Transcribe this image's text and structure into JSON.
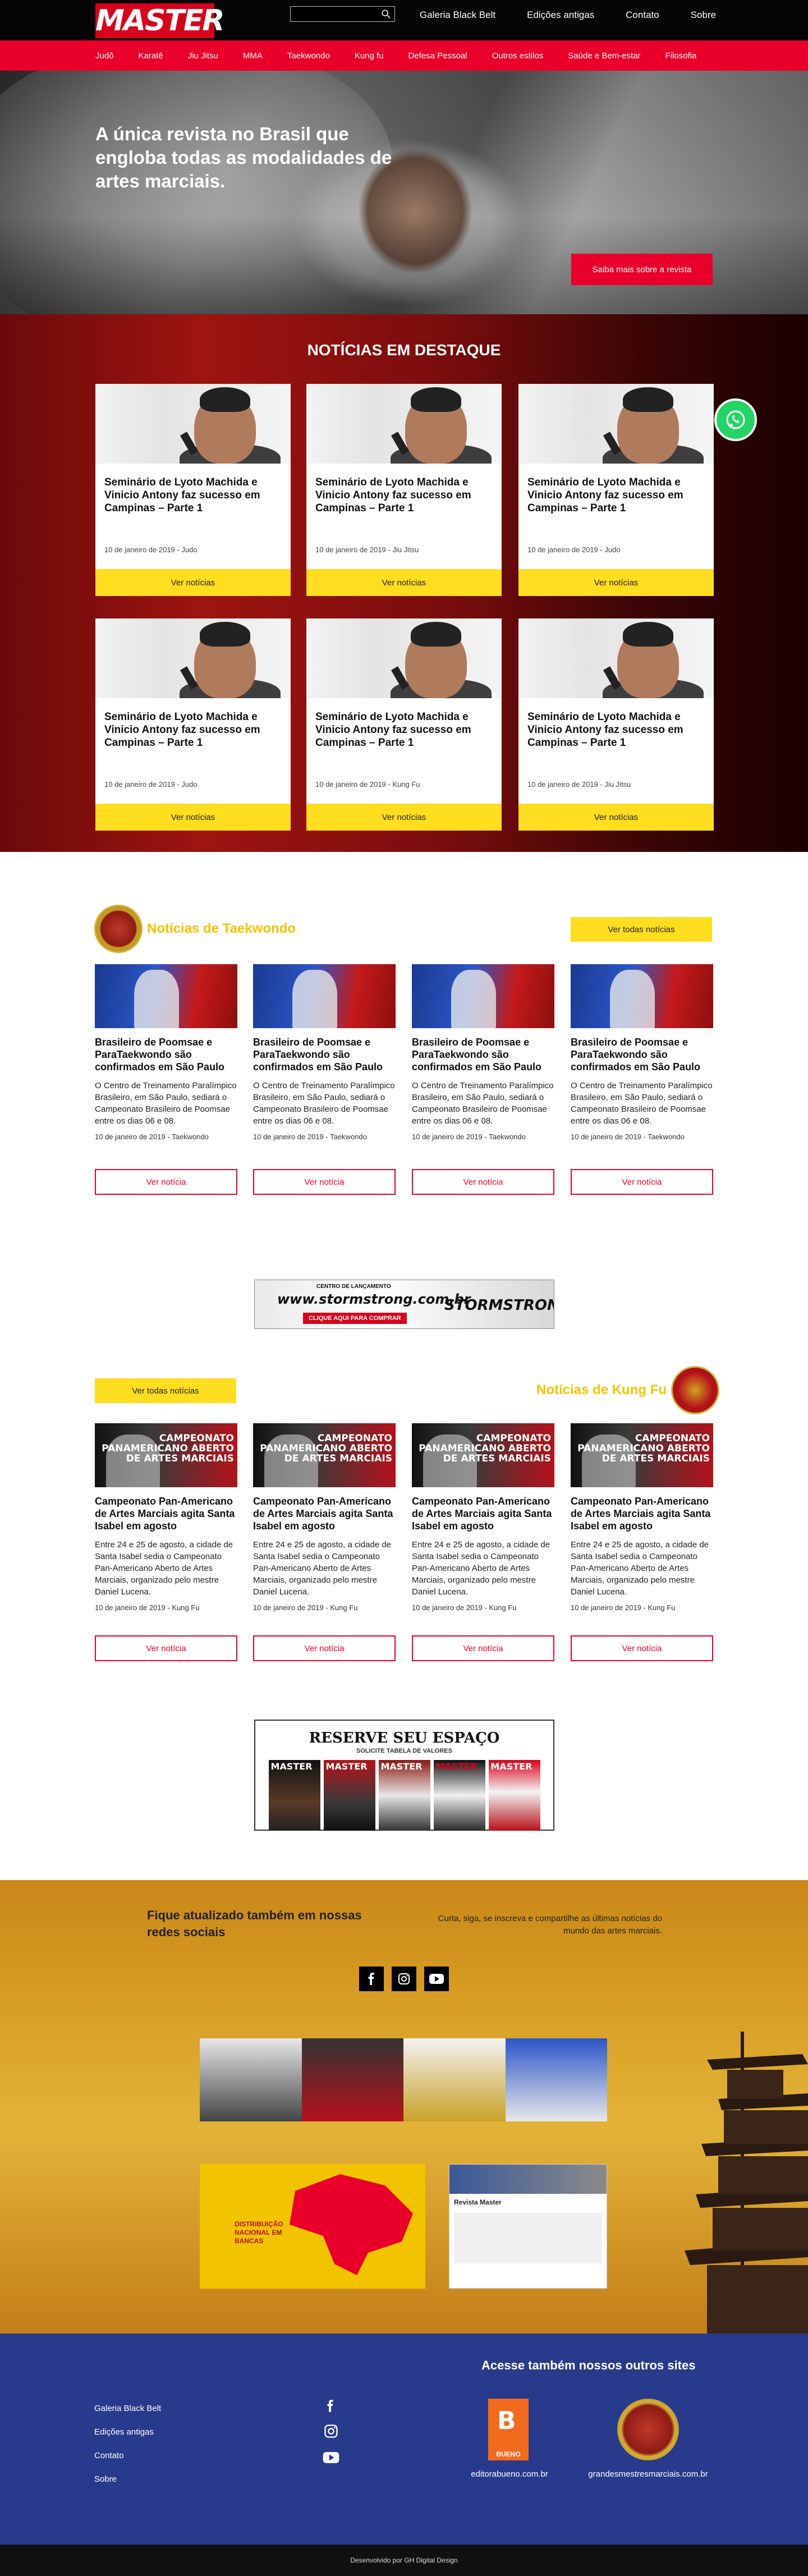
{
  "header": {
    "logo": "MASTER",
    "search_placeholder": "",
    "toplinks": [
      "Galeria Black Belt",
      "Edições antigas",
      "Contato",
      "Sobre"
    ]
  },
  "nav": [
    "Judô",
    "Karatê",
    "Jiu Jitsu",
    "MMA",
    "Taekwondo",
    "Kung fu",
    "Defesa Pessoal",
    "Outros estilos",
    "Saúde e Bem-estar",
    "Filosofia"
  ],
  "hero": {
    "headline": "A única revista no Brasil que engloba todas as modalidades de artes marciais.",
    "cta": "Saiba mais sobre a revista"
  },
  "news": {
    "title": "NOTÍCIAS EM DESTAQUE",
    "button": "Ver notícias",
    "items": [
      {
        "title": "Seminário de Lyoto Machida e Vinicio Antony faz sucesso em Campinas – Parte 1",
        "meta": "10 de janeiro de 2019 - Judo"
      },
      {
        "title": "Seminário de Lyoto Machida e Vinicio Antony faz sucesso em Campinas – Parte 1",
        "meta": "10 de janeiro de 2019 - Jiu Jitsu"
      },
      {
        "title": "Seminário de Lyoto Machida e Vinicio Antony faz sucesso em Campinas – Parte 1",
        "meta": "10 de janeiro de 2019 - Judo"
      },
      {
        "title": "Seminário de Lyoto Machida e Vinicio Antony faz sucesso em Campinas – Parte 1",
        "meta": "10 de janeiro de 2019 - Judo"
      },
      {
        "title": "Seminário de Lyoto Machida e Vinicio Antony faz sucesso em Campinas – Parte 1",
        "meta": "10 de janeiro de 2019 - Kung Fu"
      },
      {
        "title": "Seminário de Lyoto Machida e Vinicio Antony faz sucesso em Campinas – Parte 1",
        "meta": "10 de janeiro de 2019 - Jiu Jitsu"
      }
    ]
  },
  "taekwondo": {
    "title": "Notícias de Taekwondo",
    "all_button": "Ver todas notícias",
    "item_button": "Ver notícia",
    "items": [
      {
        "title": "Brasileiro de Poomsae e ParaTaekwondo são confirmados em São Paulo",
        "excerpt": "O Centro de Treinamento Paralímpico Brasileiro, em São Paulo, sediará o Campeonato Brasileiro de Poomsae entre os dias 06 e 08.",
        "meta": "10 de janeiro de 2019 - Taekwondo"
      },
      {
        "title": "Brasileiro de Poomsae e ParaTaekwondo são confirmados em São Paulo",
        "excerpt": "O Centro de Treinamento Paralímpico Brasileiro, em São Paulo, sediará o Campeonato Brasileiro de Poomsae entre os dias 06 e 08.",
        "meta": "10 de janeiro de 2019 - Taekwondo"
      },
      {
        "title": "Brasileiro de Poomsae e ParaTaekwondo são confirmados em São Paulo",
        "excerpt": "O Centro de Treinamento Paralímpico Brasileiro, em São Paulo, sediará o Campeonato Brasileiro de Poomsae entre os dias 06 e 08.",
        "meta": "10 de janeiro de 2019 - Taekwondo"
      },
      {
        "title": "Brasileiro de Poomsae e ParaTaekwondo são confirmados em São Paulo",
        "excerpt": "O Centro de Treinamento Paralímpico Brasileiro, em São Paulo, sediará o Campeonato Brasileiro de Poomsae entre os dias 06 e 08.",
        "meta": "10 de janeiro de 2019 - Taekwondo"
      }
    ]
  },
  "banner1": {
    "line1": "CENTRO DE LANÇAMENTO",
    "url": "www.stormstrong.com.br",
    "cta": "CLIQUE AQUI PARA COMPRAR",
    "brand": "STORMSTRONG"
  },
  "kungfu": {
    "title": "Notícias de Kung Fu",
    "all_button": "Ver todas notícias",
    "item_button": "Ver notícia",
    "image_text": "CAMPEONATO PANAMERICANO ABERTO DE ARTES MARCIAIS",
    "items": [
      {
        "title": "Campeonato Pan-Americano de Artes Marciais agita Santa Isabel em agosto",
        "excerpt": "Entre 24 e 25 de agosto, a cidade de Santa Isabel sedia o Campeonato Pan-Americano Aberto de Artes Marciais, organizado pelo mestre Daniel Lucena.",
        "meta": "10 de janeiro de 2019 - Kung Fu"
      },
      {
        "title": "Campeonato Pan-Americano de Artes Marciais agita Santa Isabel em agosto",
        "excerpt": "Entre 24 e 25 de agosto, a cidade de Santa Isabel sedia o Campeonato Pan-Americano Aberto de Artes Marciais, organizado pelo mestre Daniel Lucena.",
        "meta": "10 de janeiro de 2019 - Kung Fu"
      },
      {
        "title": "Campeonato Pan-Americano de Artes Marciais agita Santa Isabel em agosto",
        "excerpt": "Entre 24 e 25 de agosto, a cidade de Santa Isabel sedia o Campeonato Pan-Americano Aberto de Artes Marciais, organizado pelo mestre Daniel Lucena.",
        "meta": "10 de janeiro de 2019 - Kung Fu"
      },
      {
        "title": "Campeonato Pan-Americano de Artes Marciais agita Santa Isabel em agosto",
        "excerpt": "Entre 24 e 25 de agosto, a cidade de Santa Isabel sedia o Campeonato Pan-Americano Aberto de Artes Marciais, organizado pelo mestre Daniel Lucena.",
        "meta": "10 de janeiro de 2019 - Kung Fu"
      }
    ]
  },
  "banner2": {
    "title": "RESERVE SEU ESPAÇO",
    "subtitle": "SOLICITE TABELA DE VALORES",
    "covers": [
      "MASTER",
      "MASTER",
      "MASTER",
      "MASTER",
      "MASTER"
    ]
  },
  "social": {
    "heading": "Fique atualizado também em nossas redes sociais",
    "text": "Curta, siga, se inscreva e compartilhe as últimas notícias do mundo das artes marciais.",
    "icons": [
      "facebook-icon",
      "instagram-icon",
      "youtube-icon"
    ],
    "video_text": "DISTRIBUIÇÃO NACIONAL EM BANCAS",
    "fb_title": "Revista Master"
  },
  "footer": {
    "heading": "Acesse também nossos outros sites",
    "links": [
      "Galeria Black Belt",
      "Edições antigas",
      "Contato",
      "Sobre"
    ],
    "site1": "editorabueno.com.br",
    "site1_logo": "BUENO",
    "site2": "grandesmestresmarciais.com.br",
    "credit": "Desenvolvido por GH Digital Design"
  },
  "colors": {
    "red": "#e8002a",
    "yellow": "#ffdd1f",
    "blue": "#283a8c",
    "gold": "#f2c300"
  }
}
